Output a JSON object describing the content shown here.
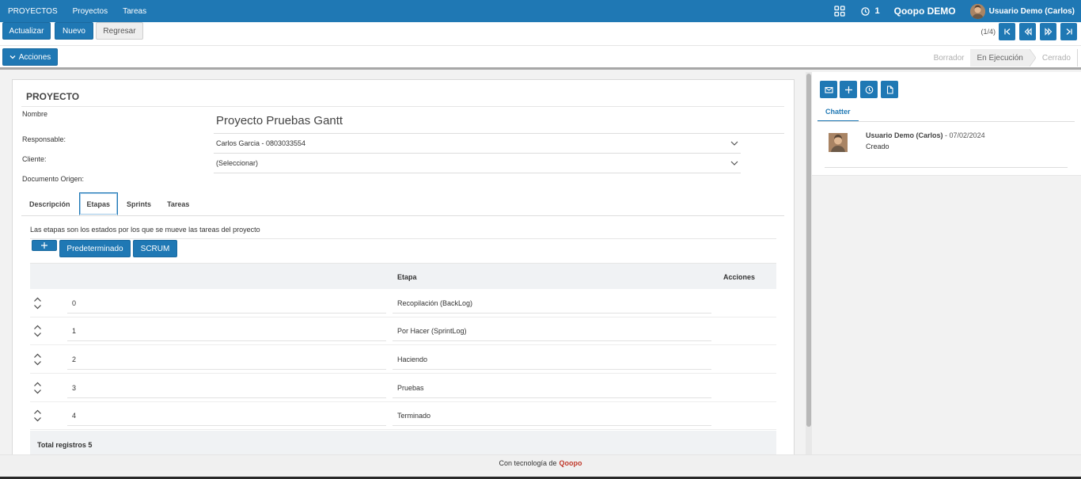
{
  "navbar": {
    "brand": "PROYECTOS",
    "links": [
      "Proyectos",
      "Tareas"
    ],
    "notification_count": "1",
    "company": "Qoopo DEMO",
    "user": "Usuario Demo (Carlos)"
  },
  "toolbar": {
    "update_label": "Actualizar",
    "new_label": "Nuevo",
    "back_label": "Regresar",
    "pager_count": "(1/4)"
  },
  "actions": {
    "label": "Acciones",
    "status_steps": [
      "Borrador",
      "En Ejecución",
      "Cerrado"
    ],
    "active_step": "En Ejecución"
  },
  "form": {
    "title": "PROYECTO",
    "name_label": "Nombre",
    "name_value": "Proyecto Pruebas Gantt",
    "responsable_label": "Responsable:",
    "responsable_value": "Carlos Garcia - 0803033554",
    "cliente_label": "Cliente:",
    "cliente_value": "(Seleccionar)",
    "documento_label": "Documento Origen:"
  },
  "tabs": [
    "Descripción",
    "Etapas",
    "Sprints",
    "Tareas"
  ],
  "active_tab": "Etapas",
  "etapas": {
    "description": "Las etapas son los estados por los que se mueve las tareas del proyecto",
    "default_button": "Predeterminado",
    "scrum_button": "SCRUM",
    "columns": {
      "etapa": "Etapa",
      "acciones": "Acciones"
    },
    "rows": [
      {
        "index": "0",
        "etapa": "Recopilación (BackLog)"
      },
      {
        "index": "1",
        "etapa": "Por Hacer (SprintLog)"
      },
      {
        "index": "2",
        "etapa": "Haciendo"
      },
      {
        "index": "3",
        "etapa": "Pruebas"
      },
      {
        "index": "4",
        "etapa": "Terminado"
      }
    ],
    "total": "Total registros 5"
  },
  "chatter": {
    "tab_label": "Chatter",
    "message": {
      "author": "Usuario Demo (Carlos)",
      "date": " - 07/02/2024",
      "text": "Creado"
    }
  },
  "footer": {
    "text": "Con tecnología de",
    "brand": "Qoopo"
  },
  "colors": {
    "primary": "#1f78b4",
    "footer_brand": "#c0392b"
  }
}
